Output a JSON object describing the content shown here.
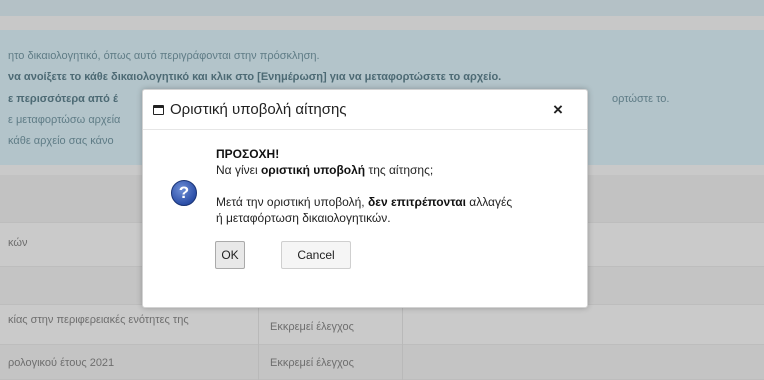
{
  "background": {
    "info_lines": {
      "l1": "ητο δικαιολογητικό, όπως αυτό περιγράφονται στην πρόσκληση.",
      "l2": "να ανοίξετε το κάθε δικαιολογητικό και κλικ στο [Ενημέρωση] για να μεταφορτώσετε το αρχείο.",
      "l3": "ε περισσότερα από έ",
      "l3_right": "ορτώστε το.",
      "l4": "ε μεταφορτώσω αρχεία",
      "l5": "κάθε αρχείο σας κάνο"
    },
    "rows": {
      "r1": "κών",
      "r3": "κίας στην περιφερειακές ενότητες της",
      "r3_status": "Εκκρεμεί έλεγχος",
      "r4": "ρολογικού έτους 2021",
      "r4_status": "Εκκρεμεί έλεγχος"
    }
  },
  "dialog": {
    "title": "Οριστική υποβολή αίτησης",
    "close": "×",
    "icon_glyph": "?",
    "warning_title": "ΠΡΟΣΟΧΗ!",
    "line1_pre": "Να γίνει ",
    "line1_bold": "οριστική υποβολή",
    "line1_post": " της αίτησης;",
    "line2_pre": "Μετά την οριστική υποβολή, ",
    "line2_bold": "δεν επιτρέπονται",
    "line2_post": " αλλαγές",
    "line3": "ή μεταφόρτωση δικαιολογητικών.",
    "ok_label": "OK",
    "cancel_label": "Cancel"
  },
  "icons": {
    "window": "window-icon",
    "close": "close-icon",
    "question": "question-icon"
  }
}
